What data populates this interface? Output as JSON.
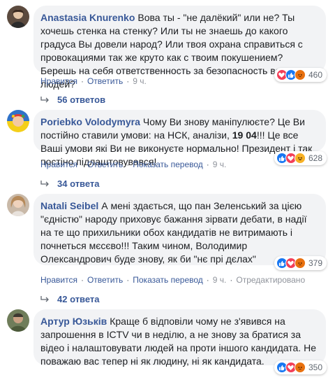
{
  "comments": [
    {
      "author": "Anastasia Knurenko",
      "text": "Вова ты - \"не далёкий\" или не? Ты хочешь стенка на стенку? Или ты не знаешь до какого градуса Вы довели народ? Или твоя охрана справиться с провокациями так же круто как с твоим покушением? Берешь на себя ответственность за безопасность всех людей?",
      "reaction_count": "460",
      "reactions": [
        "love",
        "like",
        "angry"
      ],
      "like_label": "Нравится",
      "reply_label": "Ответить",
      "time": "9 ч.",
      "replies_label": "56 ответов"
    },
    {
      "author": "Poriebko Volodymyra",
      "text_before": "Чому Ви знову маніпулюєте? Це Ви постійно ставили умови: на НСК, аналізи,",
      "text_bold": "19 04",
      "text_after": "!!! Це все Ваші умови які Ви не виконуєте нормально! Президент і так постіно підлаштовувався!",
      "reaction_count": "628",
      "reactions": [
        "like",
        "love",
        "haha"
      ],
      "like_label": "Нравится",
      "reply_label": "Ответить",
      "translate_label": "Показать перевод",
      "time": "9 ч.",
      "replies_label": "34 ответа"
    },
    {
      "author": "Natali Seibel",
      "text": "А мені здається, що пан Зеленський за цією \"єдністю\" народу приховує бажання зірвати дебати, в надії на те що прихильники обох кандидатів не витримають і почнеться мєсєво!!! Таким чином, Володимир Олександрович буде знову, як би \"нє прі дєлах\"",
      "reaction_count": "379",
      "reactions": [
        "like",
        "love",
        "angry"
      ],
      "like_label": "Нравится",
      "reply_label": "Ответить",
      "translate_label": "Показать перевод",
      "time": "9 ч.",
      "edited_label": "Отредактировано",
      "replies_label": "42 ответа"
    },
    {
      "author": "Артур Юзьків",
      "text": "Краще б відповіли чому не з'явився на запрошення в ICTV чи в неділю, а не знову за братися за відео і налаштовувати людей на проти іншого кандидата. Не поважаю вас тепер ні як людину, ні як кандидата.",
      "reaction_count": "350",
      "reactions": [
        "like",
        "love",
        "angry"
      ]
    }
  ],
  "colors": {
    "link": "#385898",
    "bubble": "#f2f3f5",
    "like": "#1877f2",
    "love": "#f33e58",
    "haha": "#f7b125",
    "angry": "#e9710f"
  }
}
